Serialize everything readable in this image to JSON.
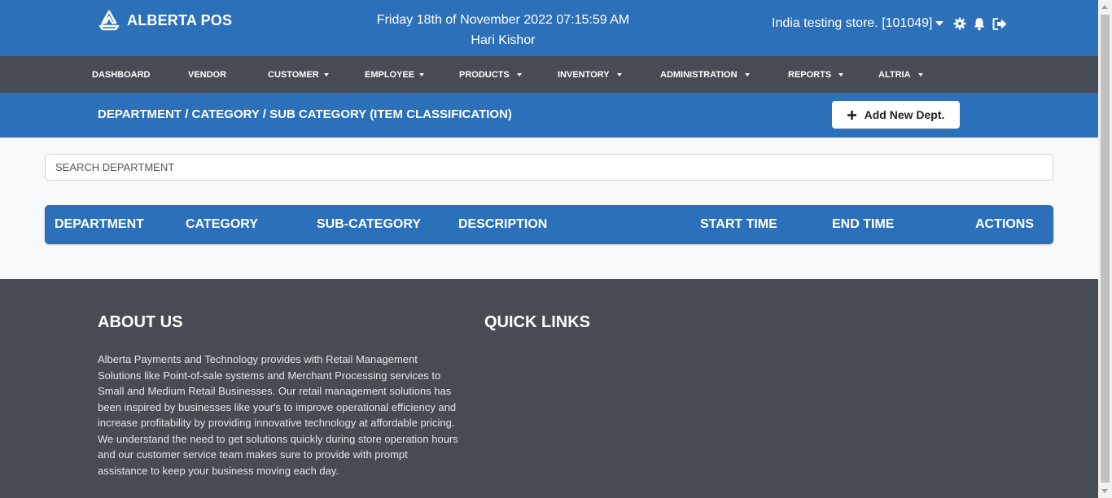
{
  "header": {
    "brand": "ALBERTA POS",
    "datetime": "Friday 18th of November 2022 07:15:59 AM",
    "user": "Hari Kishor",
    "store": "India testing store. [101049]"
  },
  "nav": {
    "items": [
      {
        "label": "DASHBOARD",
        "dropdown": false
      },
      {
        "label": "VENDOR",
        "dropdown": false
      },
      {
        "label": "CUSTOMER",
        "dropdown": true
      },
      {
        "label": "EMPLOYEE",
        "dropdown": true
      },
      {
        "label": "PRODUCTS",
        "dropdown": true
      },
      {
        "label": "INVENTORY",
        "dropdown": true
      },
      {
        "label": "ADMINISTRATION",
        "dropdown": true
      },
      {
        "label": "REPORTS",
        "dropdown": true
      },
      {
        "label": "ALTRIA",
        "dropdown": true
      }
    ]
  },
  "page": {
    "title": "DEPARTMENT / CATEGORY / SUB CATEGORY (ITEM CLASSIFICATION)",
    "add_button": "Add New Dept."
  },
  "search": {
    "placeholder": "SEARCH DEPARTMENT",
    "value": ""
  },
  "table": {
    "columns": [
      "DEPARTMENT",
      "CATEGORY",
      "SUB-CATEGORY",
      "DESCRIPTION",
      "START TIME",
      "END TIME",
      "ACTIONS"
    ]
  },
  "footer": {
    "about_title": "ABOUT US",
    "about_text": "Alberta Payments and Technology provides with Retail Management Solutions like Point-of-sale systems and Merchant Processing services to Small and Medium Retail Businesses. Our retail management solutions has been inspired by businesses like your's to improve operational efficiency and increase profitability by providing innovative technology at affordable pricing. We understand the need to get solutions quickly during store operation hours and our customer service team makes sure to provide with prompt assistance to keep your business moving each day.",
    "links_title": "QUICK LINKS"
  },
  "colors": {
    "primary": "#2c70b9",
    "nav_bg": "#474b53",
    "footer_bg": "#474b53"
  },
  "icons": [
    "alberta-logo-icon",
    "caret-down-icon",
    "gear-icon",
    "bell-icon",
    "sign-out-icon",
    "plus-icon"
  ]
}
